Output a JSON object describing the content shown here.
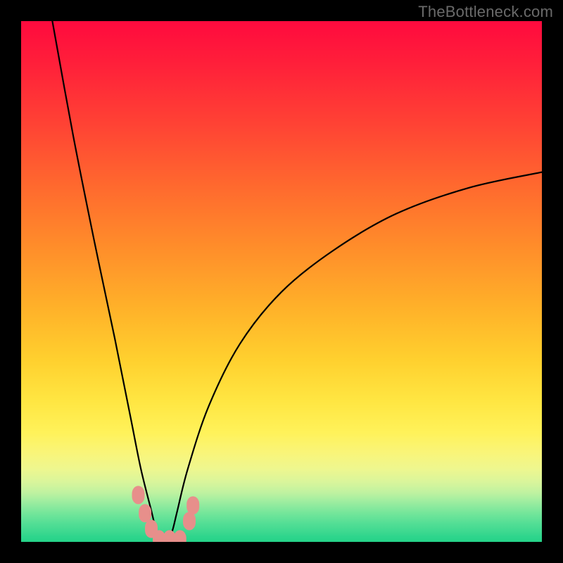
{
  "watermark": "TheBottleneck.com",
  "chart_data": {
    "type": "line",
    "title": "",
    "xlabel": "",
    "ylabel": "",
    "xlim": [
      0,
      100
    ],
    "ylim": [
      0,
      100
    ],
    "curve_description": "V-shaped bottleneck curve on red-to-green gradient; minimum near x≈27 at y≈0 (green band). Left branch rises steeply to y≈100 at x≈6; right branch rises with decreasing slope to y≈71 at x=100.",
    "series": [
      {
        "name": "bottleneck-curve",
        "x": [
          6,
          10,
          14,
          18,
          21,
          23,
          25,
          26,
          27,
          28,
          29,
          30,
          32,
          36,
          42,
          50,
          60,
          72,
          86,
          100
        ],
        "y": [
          100,
          78,
          58,
          39,
          24,
          14,
          6,
          2,
          0,
          0,
          2,
          6,
          14,
          26,
          38,
          48,
          56,
          63,
          68,
          71
        ]
      }
    ],
    "markers": {
      "description": "Salmon-colored rounded markers clustered near the curve minimum",
      "color": "#e78f8b",
      "points": [
        {
          "x": 22.5,
          "y": 9.0
        },
        {
          "x": 23.8,
          "y": 5.5
        },
        {
          "x": 25.0,
          "y": 2.5
        },
        {
          "x": 26.5,
          "y": 0.5
        },
        {
          "x": 28.5,
          "y": 0.5
        },
        {
          "x": 30.5,
          "y": 0.5
        },
        {
          "x": 32.3,
          "y": 4.0
        },
        {
          "x": 33.0,
          "y": 7.0
        }
      ]
    },
    "gradient_stops": [
      {
        "pct": 0,
        "color": "#ff0a3e"
      },
      {
        "pct": 50,
        "color": "#ffb129"
      },
      {
        "pct": 80,
        "color": "#fff25a"
      },
      {
        "pct": 100,
        "color": "#25d389"
      }
    ]
  }
}
